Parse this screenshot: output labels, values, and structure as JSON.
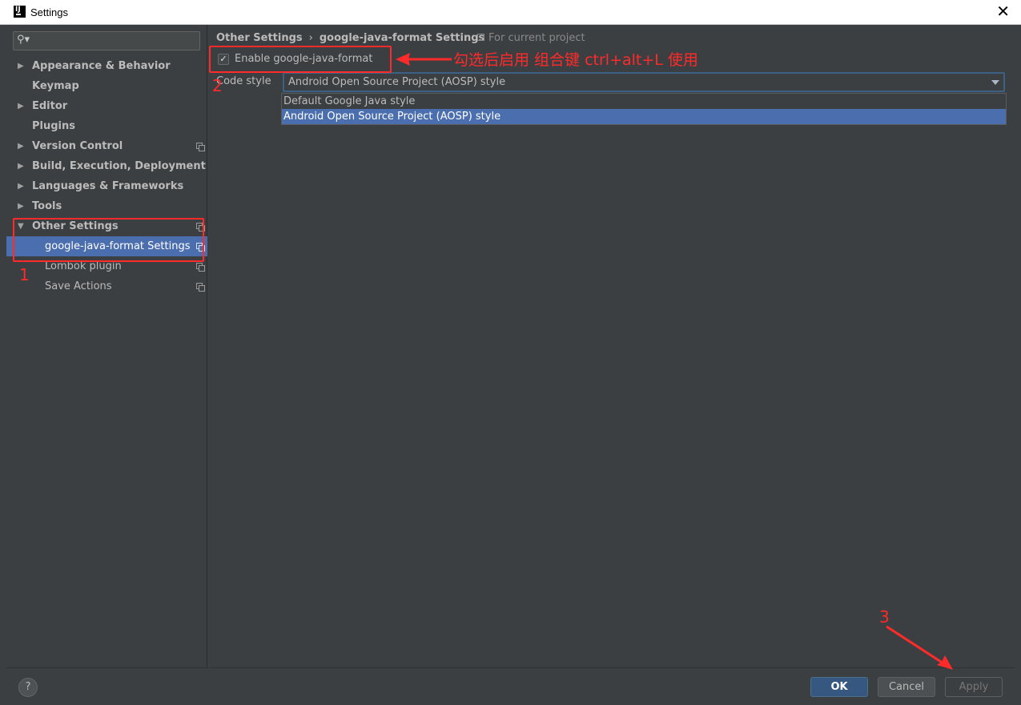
{
  "window": {
    "title": "Settings",
    "close_glyph": "✕"
  },
  "sidebar": {
    "search": {
      "value": "",
      "placeholder": ""
    },
    "items": [
      {
        "label": "Appearance & Behavior",
        "expandable": true,
        "expanded": false,
        "level": 0,
        "project": false
      },
      {
        "label": "Keymap",
        "expandable": false,
        "level": 0,
        "project": false
      },
      {
        "label": "Editor",
        "expandable": true,
        "expanded": false,
        "level": 0,
        "project": false
      },
      {
        "label": "Plugins",
        "expandable": false,
        "level": 0,
        "project": false
      },
      {
        "label": "Version Control",
        "expandable": true,
        "expanded": false,
        "level": 0,
        "project": true
      },
      {
        "label": "Build, Execution, Deployment",
        "expandable": true,
        "expanded": false,
        "level": 0,
        "project": false
      },
      {
        "label": "Languages & Frameworks",
        "expandable": true,
        "expanded": false,
        "level": 0,
        "project": false
      },
      {
        "label": "Tools",
        "expandable": true,
        "expanded": false,
        "level": 0,
        "project": false
      },
      {
        "label": "Other Settings",
        "expandable": true,
        "expanded": true,
        "level": 0,
        "project": true
      },
      {
        "label": "google-java-format Settings",
        "expandable": false,
        "level": 1,
        "project": true,
        "selected": true
      },
      {
        "label": "Lombok plugin",
        "expandable": false,
        "level": 1,
        "project": true
      },
      {
        "label": "Save Actions",
        "expandable": false,
        "level": 1,
        "project": true
      }
    ]
  },
  "content": {
    "breadcrumb": {
      "parent": "Other Settings",
      "separator": "›",
      "current": "google-java-format Settings"
    },
    "scope_label": "For current project",
    "enable": {
      "label": "Enable google-java-format",
      "checked": true,
      "check_glyph": "✓"
    },
    "code_style": {
      "label": "Code style",
      "selected": "Android Open Source Project (AOSP) style",
      "options": [
        "Default Google Java style",
        "Android Open Source Project (AOSP) style"
      ],
      "highlighted_index": 1
    }
  },
  "footer": {
    "help_label": "?",
    "ok_label": "OK",
    "cancel_label": "Cancel",
    "apply_label": "Apply",
    "apply_enabled": false
  },
  "annotations": {
    "color": "#ff2a2a",
    "step1": "1",
    "step2": "2",
    "step3": "3",
    "note": "勾选后启用  组合键 ctrl+alt+L 使用"
  },
  "colors": {
    "background": "#3c3f41",
    "selection": "#4b6eaf",
    "ok_button": "#365880",
    "text": "#bbbbbb"
  }
}
